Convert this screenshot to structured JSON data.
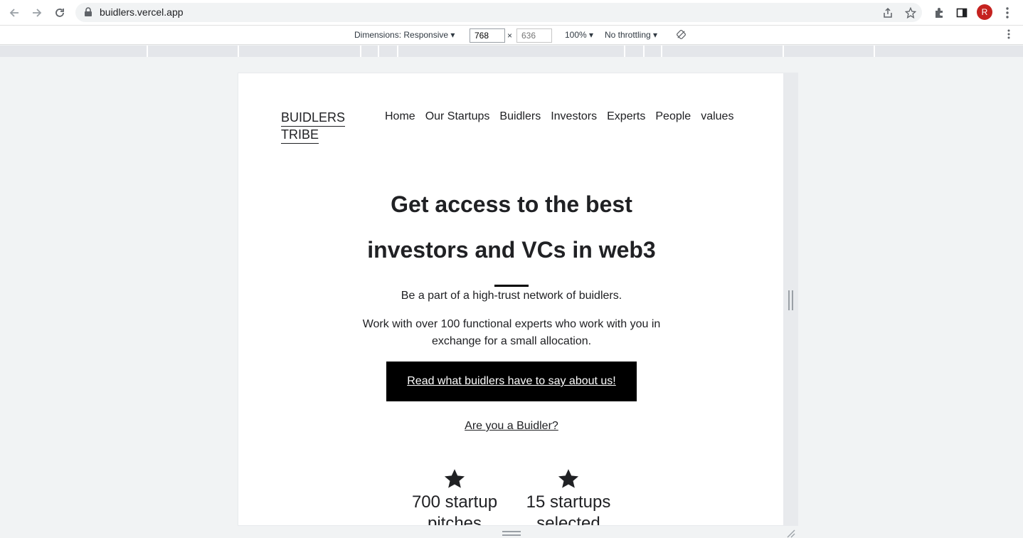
{
  "browser": {
    "url": "buidlers.vercel.app",
    "avatar_letter": "R"
  },
  "devtools": {
    "dimensions_label": "Dimensions: Responsive ▾",
    "width_value": "768",
    "times": "×",
    "height_placeholder": "636",
    "zoom_label": "100% ▾",
    "throttle_label": "No throttling ▾"
  },
  "site": {
    "logo_line1": "BUIDLERS",
    "logo_line2": "TRIBE",
    "nav": [
      "Home",
      "Our Startups",
      "Buidlers",
      "Investors",
      "Experts",
      "People",
      "values"
    ],
    "headline_line1": "Get access to the best",
    "headline_line2": "investors and VCs in web3",
    "tagline": "Be a part of a high-trust network of buidlers.",
    "desc_line1": "Work with over 100 functional experts who work with you in",
    "desc_line2": "exchange for a small allocation.",
    "cta_label": "Read what buidlers have to say about us!",
    "secondary_link": "Are you a Buidler?",
    "stats": [
      {
        "value": "700 startup",
        "cut": "pitches"
      },
      {
        "value": "15 startups",
        "cut": "selected"
      }
    ]
  },
  "colors": {
    "cta_bg": "#000000",
    "avatar_bg": "#c5221f"
  }
}
